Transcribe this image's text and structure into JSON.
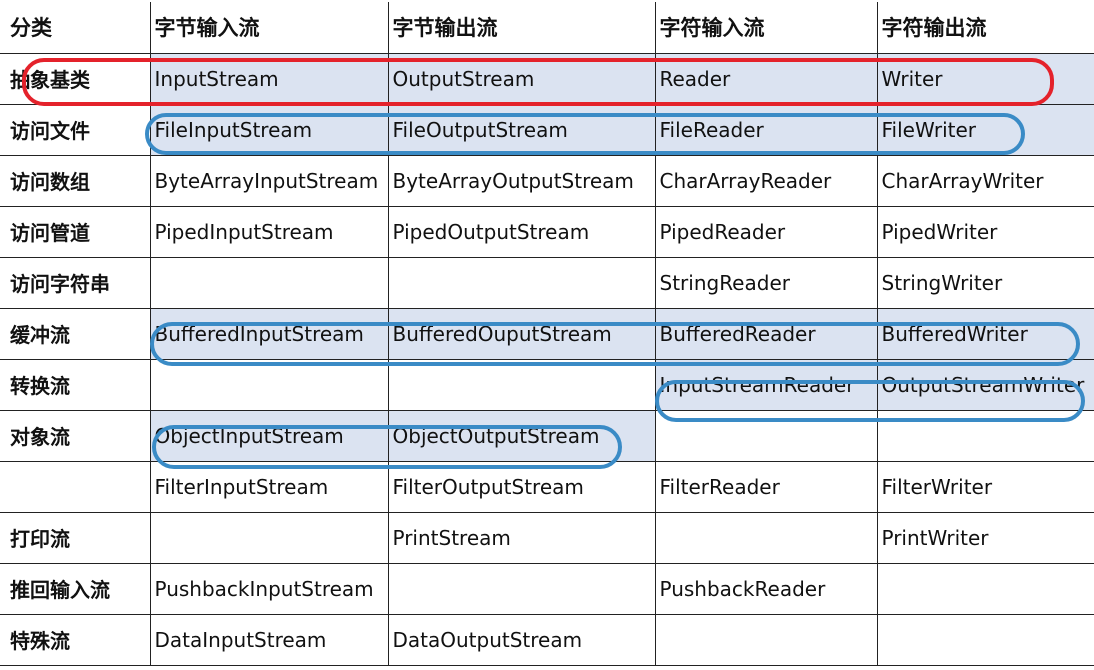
{
  "header": [
    "分类",
    "字节输入流",
    "字节输出流",
    "字符输入流",
    "字符输出流"
  ],
  "rows": [
    {
      "category": "抽象基类",
      "cells": [
        "InputStream",
        "OutputStream",
        "Reader",
        "Writer"
      ],
      "hl": [
        true,
        true,
        true,
        true
      ]
    },
    {
      "category": "访问文件",
      "cells": [
        "FileInputStream",
        "FileOutputStream",
        "FileReader",
        "FileWriter"
      ],
      "hl": [
        true,
        true,
        true,
        true
      ]
    },
    {
      "category": "访问数组",
      "cells": [
        "ByteArrayInputStream",
        "ByteArrayOutputStream",
        "CharArrayReader",
        "CharArrayWriter"
      ],
      "hl": [
        false,
        false,
        false,
        false
      ]
    },
    {
      "category": "访问管道",
      "cells": [
        "PipedInputStream",
        "PipedOutputStream",
        "PipedReader",
        "PipedWriter"
      ],
      "hl": [
        false,
        false,
        false,
        false
      ]
    },
    {
      "category": "访问字符串",
      "cells": [
        "",
        "",
        "StringReader",
        "StringWriter"
      ],
      "hl": [
        false,
        false,
        false,
        false
      ]
    },
    {
      "category": "缓冲流",
      "cells": [
        "BufferedInputStream",
        "BufferedOuputStream",
        "BufferedReader",
        "BufferedWriter"
      ],
      "hl": [
        true,
        true,
        true,
        true
      ]
    },
    {
      "category": "转换流",
      "cells": [
        "",
        "",
        "InputStreamReader",
        "OutputStreamWriter"
      ],
      "hl": [
        false,
        false,
        true,
        true
      ]
    },
    {
      "category": "对象流",
      "cells": [
        "ObjectInputStream",
        "ObjectOutputStream",
        "",
        ""
      ],
      "hl": [
        true,
        true,
        false,
        false
      ]
    },
    {
      "category": "",
      "cells": [
        "FilterInputStream",
        "FilterOutputStream",
        "FilterReader",
        "FilterWriter"
      ],
      "hl": [
        false,
        false,
        false,
        false
      ]
    },
    {
      "category": "打印流",
      "cells": [
        "",
        "PrintStream",
        "",
        "PrintWriter"
      ],
      "hl": [
        false,
        false,
        false,
        false
      ]
    },
    {
      "category": "推回输入流",
      "cells": [
        "PushbackInputStream",
        "",
        "PushbackReader",
        ""
      ],
      "hl": [
        false,
        false,
        false,
        false
      ]
    },
    {
      "category": "特殊流",
      "cells": [
        "DataInputStream",
        "DataOutputStream",
        "",
        ""
      ],
      "hl": [
        false,
        false,
        false,
        false
      ]
    }
  ],
  "colors": {
    "highlight": "#dbe3f1",
    "red_oval": "#e4222b",
    "blue_oval": "#3a8bc6"
  }
}
